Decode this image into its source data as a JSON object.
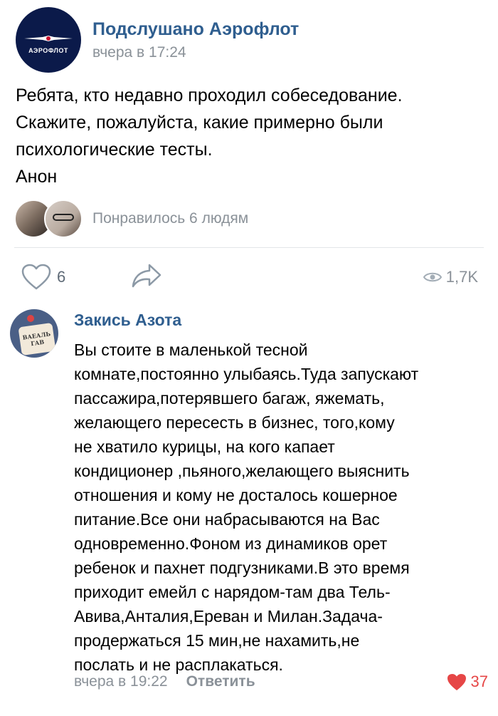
{
  "post": {
    "group_name": "Подслушано Аэрофлот",
    "time": "вчера в 17:24",
    "avatar_brand": "АЭРОФЛОТ",
    "lines": [
      "Ребята, кто недавно проходил собеседование.",
      "Скажите, пожалуйста, какие примерно были",
      "психологические тесты.",
      "Анон"
    ],
    "likes_text": "Понравилось 6 людям",
    "like_count": "6",
    "views": "1,7K"
  },
  "comment": {
    "author": "Закись Азота",
    "avatar_text": "ВАЕАЛЬ ГАВ",
    "lines": [
      "Вы стоите в маленькой тесной",
      "комнате,постоянно улыбаясь.Туда запускают",
      "пассажира,потерявшего багаж, яжемать,",
      "желающего пересесть в бизнес, того,кому",
      "не хватило курицы, на кого капает",
      "кондиционер ,пьяного,желающего выяснить",
      "отношения и кому не досталось кошерное",
      "питание.Все они набрасываются на Вас",
      "одновременно.Фоном из динамиков орет",
      "ребенок и пахнет подгузниками.В это время",
      "приходит емейл с нарядом-там два Тель-",
      "Авива,Анталия,Ереван и Милан.Задача-",
      "продержаться 15 мин,не нахамить,не",
      "послать и не расплакаться."
    ],
    "time": "вчера в 19:22",
    "reply_label": "Ответить",
    "like_count": "37"
  },
  "colors": {
    "link": "#2f5e8f",
    "meta": "#8a9198",
    "heart_active": "#e64646",
    "avatar_bg": "#0b1a4a"
  },
  "icons": {
    "like": "heart-outline-icon",
    "share": "share-arrow-icon",
    "views": "eye-icon",
    "comment_like": "heart-filled-icon"
  }
}
